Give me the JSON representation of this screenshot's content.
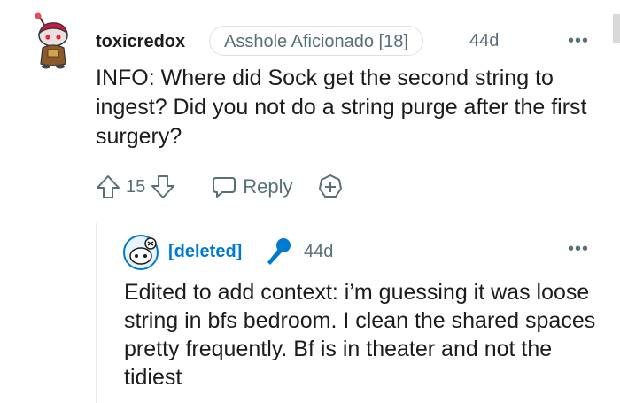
{
  "comment": {
    "username": "toxicredox",
    "flair": "Asshole Aficionado [18]",
    "age": "44d",
    "more": "•••",
    "body": "INFO: Where did Sock get the second string to ingest? Did you not do a string purge after the first surgery?",
    "votes": "15",
    "reply_label": "Reply",
    "icons": [
      "avatar",
      "upvote-icon",
      "downvote-icon",
      "reply-icon",
      "award-icon",
      "more-icon"
    ]
  },
  "reply": {
    "username": "[deleted]",
    "age": "44d",
    "more": "•••",
    "body": "Edited to add context: i’m guessing it was loose string in bfs bedroom. I clean the shared spaces pretty frequently. Bf is in theater and not the tidiest",
    "icons": [
      "avatar",
      "microphone-icon",
      "more-icon"
    ]
  },
  "colors": {
    "text": "#1c1c1c",
    "meta": "#576f76",
    "link_blue": "#0079d3",
    "flair_border": "#e0e0e0"
  }
}
